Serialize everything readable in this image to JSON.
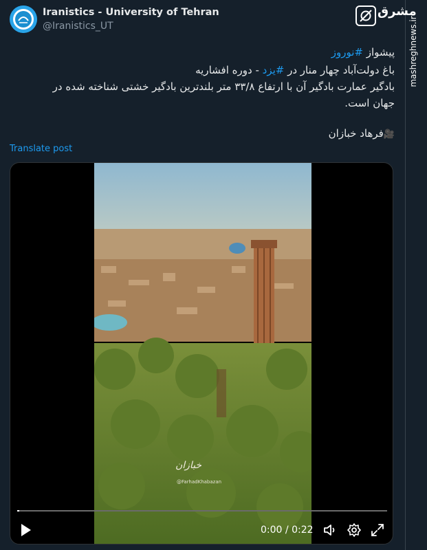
{
  "account": {
    "name": "Iranistics - University of Tehran",
    "handle": "@Iranistics_UT",
    "avatar_icon": "university-seal-icon"
  },
  "brand": {
    "name": "مشرق",
    "url": "mashreghnews.ir",
    "icon": "brand-logo-icon"
  },
  "tweet": {
    "line1_text": "پیشواز ",
    "line1_hashtag": "#نوروز",
    "line2_start": "باغ دولت‌آباد چهار منار در ",
    "line2_hashtag": "#یزد",
    "line2_end": " - دوره افشاریه",
    "line3": "بادگیر عمارت بادگیر آن با ارتفاع ۳۳/۸ متر بلندترین بادگیر خشتی شناخته شده در",
    "line4": "جهان است.",
    "credit": "فرهاد خبازان",
    "credit_icon": "movie-camera-icon",
    "hashtag_color": "#1d9bf0"
  },
  "translate_label": "Translate post",
  "video": {
    "watermark": "@FarhadKhabazan",
    "current_time": "0:00",
    "separator": " / ",
    "duration": "0:22",
    "progress": 0.005
  }
}
